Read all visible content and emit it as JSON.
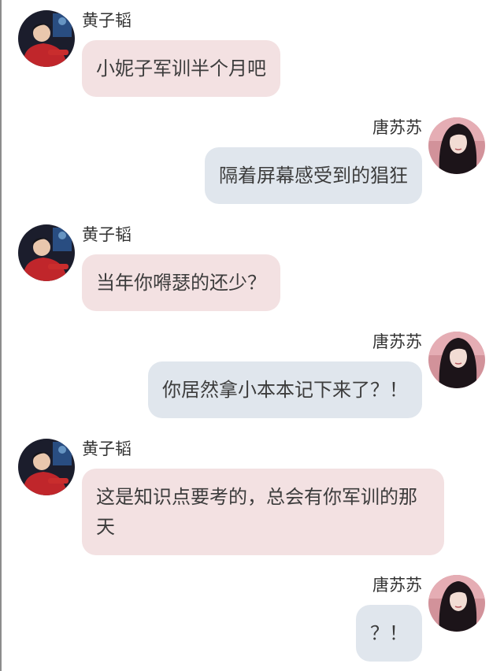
{
  "conversation": {
    "messages": [
      {
        "side": "left",
        "sender": "黄子韬",
        "text": "小妮子军训半个月吧",
        "avatar": "male-avatar"
      },
      {
        "side": "right",
        "sender": "唐苏苏",
        "text": "隔着屏幕感受到的猖狂",
        "avatar": "female-avatar"
      },
      {
        "side": "left",
        "sender": "黄子韬",
        "text": "当年你嘚瑟的还少？",
        "avatar": "male-avatar"
      },
      {
        "side": "right",
        "sender": "唐苏苏",
        "text": "你居然拿小本本记下来了？！",
        "avatar": "female-avatar"
      },
      {
        "side": "left",
        "sender": "黄子韬",
        "text": "这是知识点要考的，总会有你军训的那天",
        "avatar": "male-avatar"
      },
      {
        "side": "right",
        "sender": "唐苏苏",
        "text": "？！",
        "avatar": "female-avatar"
      }
    ]
  },
  "colors": {
    "left_bubble": "#f3e1e2",
    "right_bubble": "#e0e6ed",
    "text": "#3c3c3c",
    "name": "#333333"
  }
}
